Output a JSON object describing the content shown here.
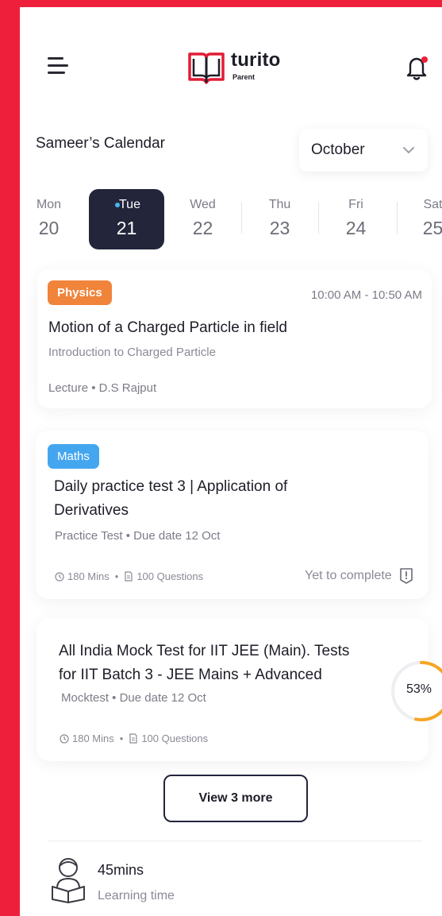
{
  "header": {
    "brand": "turito",
    "brand_sub": "Parent",
    "menu_icon": "hamburger-menu-icon",
    "notification_icon": "bell-icon",
    "notification_dot_color": "#ee1f3b"
  },
  "calendar": {
    "title": "Sameer’s Calendar",
    "month": "October",
    "days": [
      {
        "name": "Mon",
        "num": "20"
      },
      {
        "name": "Tue",
        "num": "21",
        "active": true
      },
      {
        "name": "Wed",
        "num": "22"
      },
      {
        "name": "Thu",
        "num": "23"
      },
      {
        "name": "Fri",
        "num": "24"
      },
      {
        "name": "Sat",
        "num": "25"
      }
    ]
  },
  "cards": [
    {
      "subject": "Physics",
      "time": "10:00 AM - 10:50 AM",
      "title": "Motion of a Charged Particle in field",
      "subtitle": "Introduction to Charged Particle",
      "meta": "Lecture • D.S Rajput"
    },
    {
      "subject": "Maths",
      "title_line1": "Daily practice test 3 | Application of",
      "title_line2": "Derivatives",
      "meta": "Practice Test • Due date 12 Oct",
      "duration": "180 Mins",
      "questions": "100 Questions",
      "status": "Yet to complete"
    },
    {
      "title_line1": "All India Mock Test for IIT JEE (Main). Tests",
      "title_line2": "for IIT Batch 3 - JEE Mains + Advanced",
      "meta": "Mocktest • Due date 12 Oct",
      "duration": "180 Mins",
      "questions": "100 Questions",
      "progress_label": "53%",
      "progress_value": 0.53
    }
  ],
  "view_more": "View 3 more",
  "learning": {
    "value": "45mins",
    "label": "Learning time"
  },
  "colors": {
    "accent": "#ee1f3b",
    "active_day": "#23253b",
    "physics": "#f0843b",
    "maths": "#45a6f0",
    "progress": "#f5a623"
  }
}
